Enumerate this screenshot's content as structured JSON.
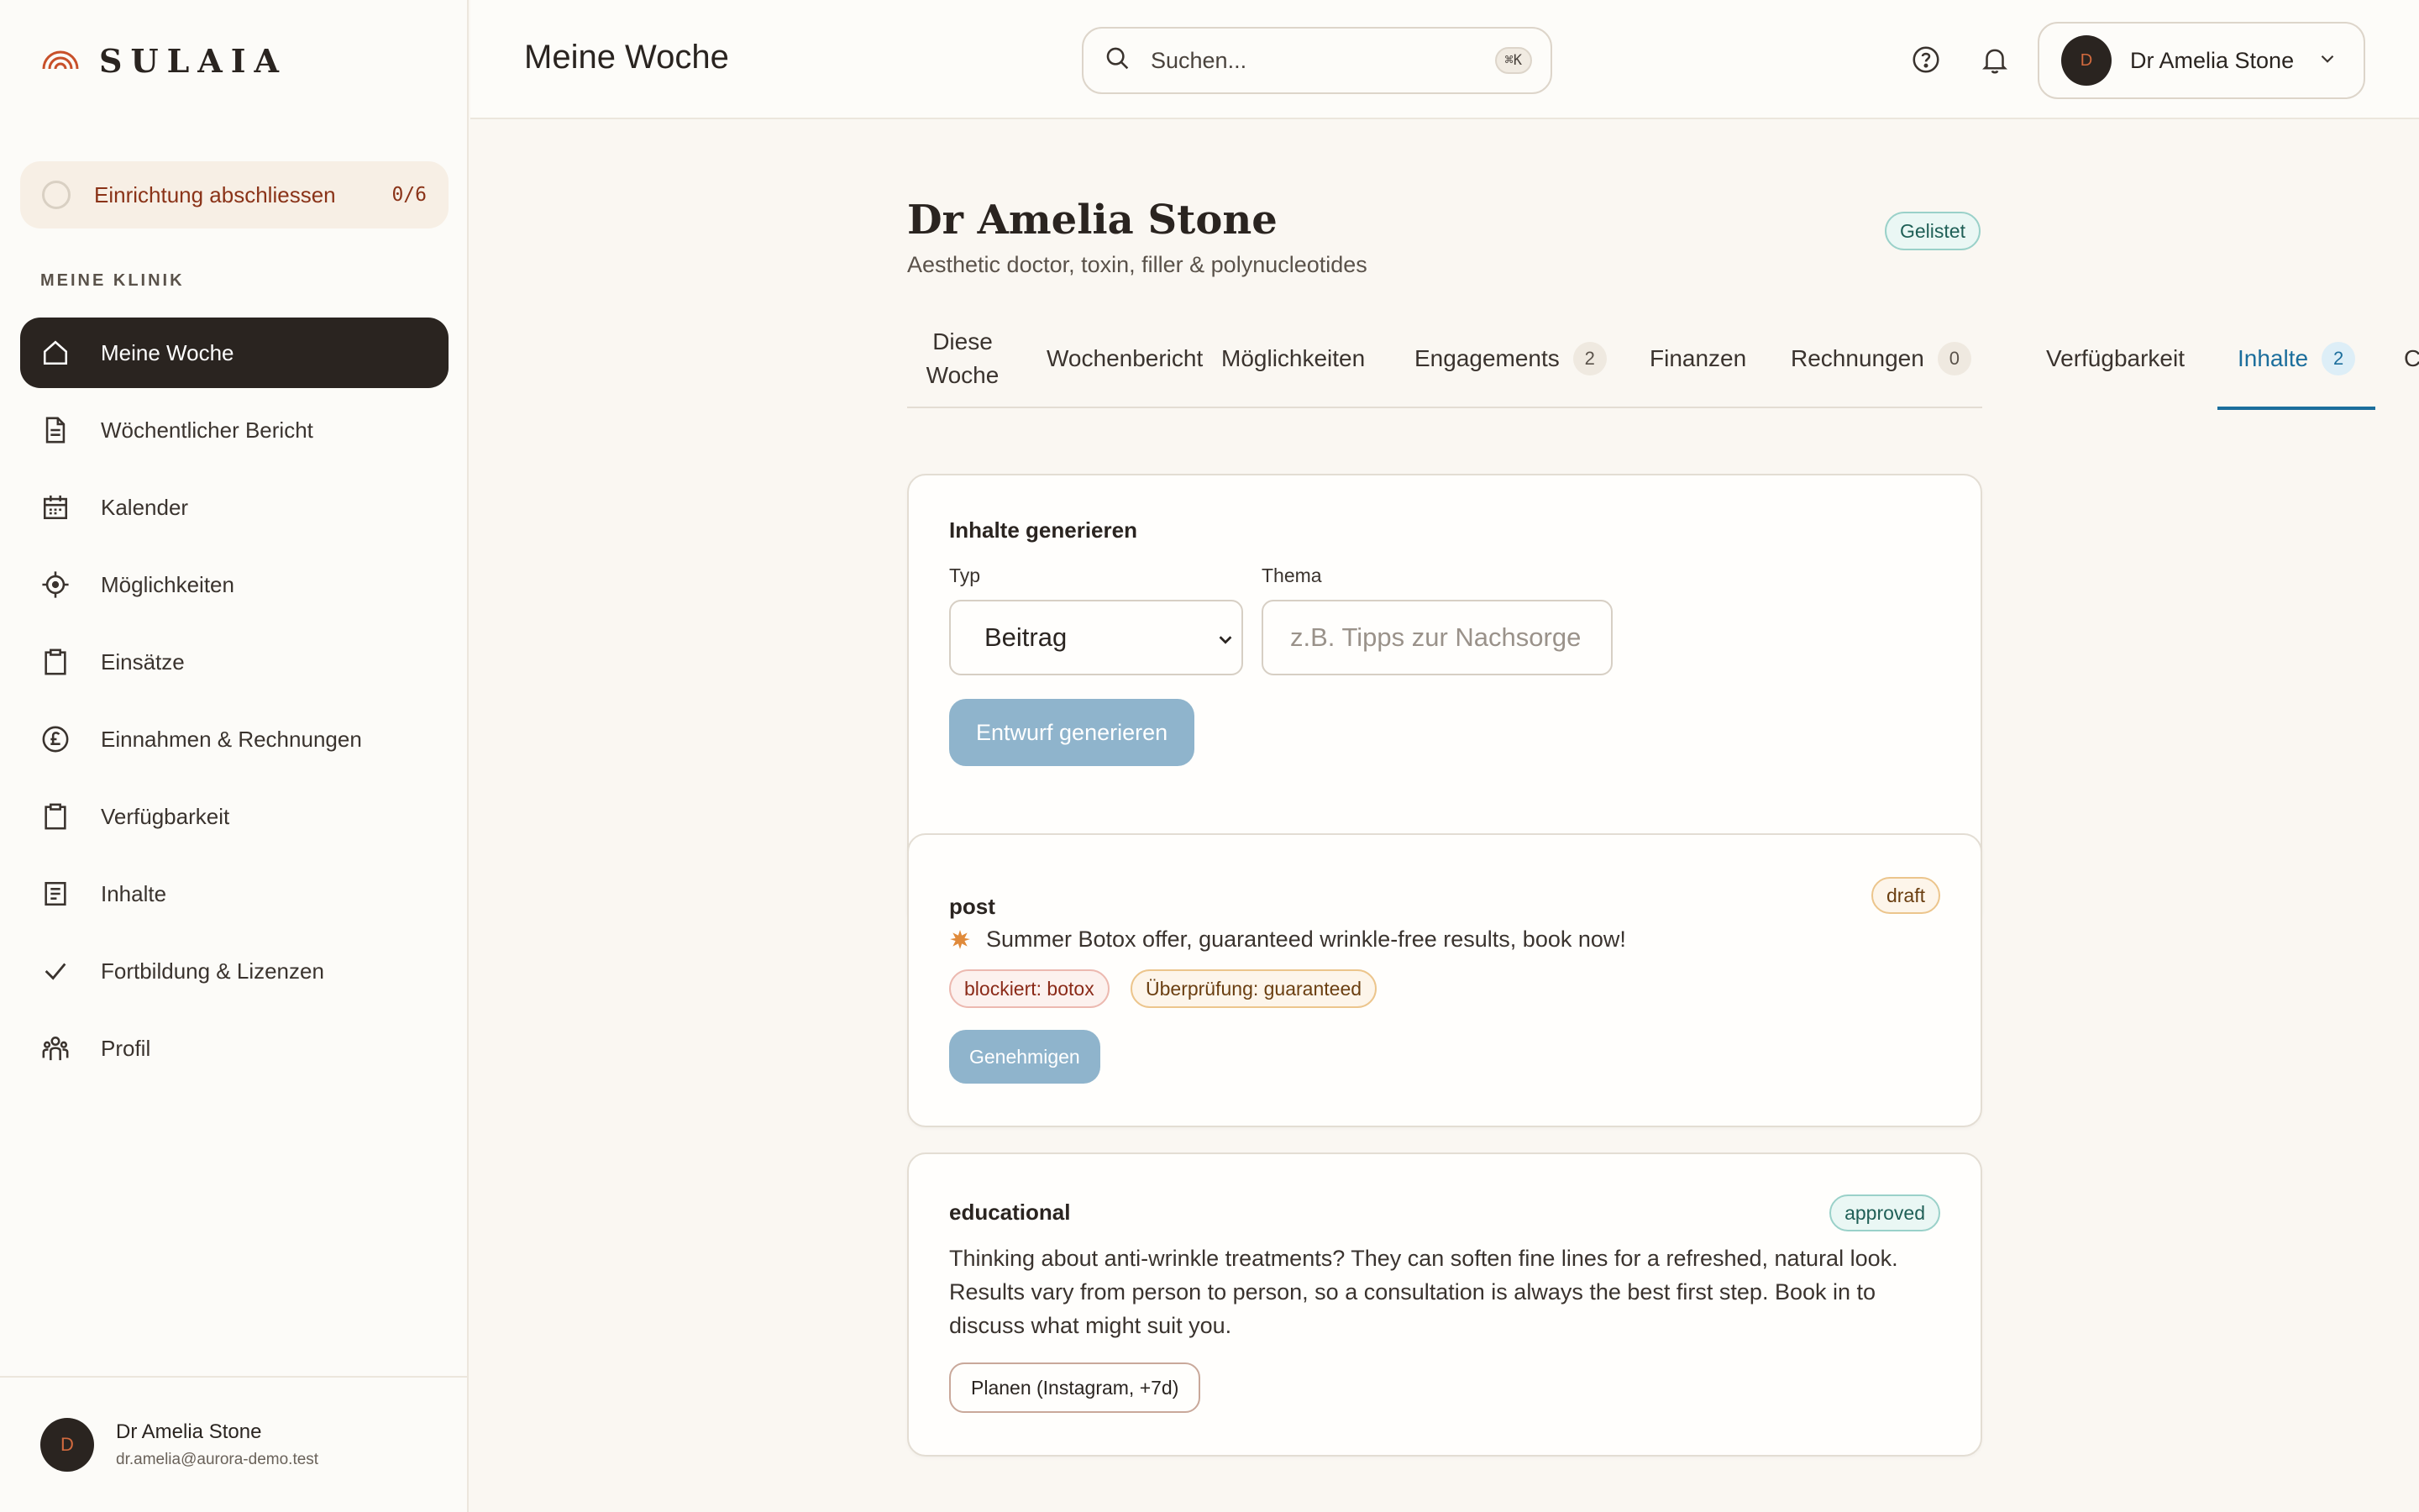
{
  "brand": {
    "name": "SULAIA"
  },
  "setup": {
    "label": "Einrichtung abschliessen",
    "count": "0/6"
  },
  "sidebar": {
    "section_label": "MEINE KLINIK",
    "items": [
      {
        "label": "Meine Woche",
        "icon": "home-icon",
        "active": true
      },
      {
        "label": "Wöchentlicher Bericht",
        "icon": "document-icon"
      },
      {
        "label": "Kalender",
        "icon": "calendar-icon"
      },
      {
        "label": "Möglichkeiten",
        "icon": "crosshair-icon"
      },
      {
        "label": "Einsätze",
        "icon": "clipboard-icon"
      },
      {
        "label": "Einnahmen & Rechnungen",
        "icon": "pound-icon"
      },
      {
        "label": "Verfügbarkeit",
        "icon": "clipboard-icon"
      },
      {
        "label": "Inhalte",
        "icon": "list-icon"
      },
      {
        "label": "Fortbildung & Lizenzen",
        "icon": "check-icon"
      },
      {
        "label": "Profil",
        "icon": "people-icon"
      }
    ],
    "footer": {
      "avatar_initial": "D",
      "name": "Dr Amelia Stone",
      "email": "dr.amelia@aurora-demo.test"
    }
  },
  "header": {
    "title": "Meine Woche",
    "search": {
      "placeholder": "Suchen...",
      "shortcut": "⌘K"
    },
    "user": {
      "avatar_initial": "D",
      "name": "Dr Amelia Stone"
    }
  },
  "profile": {
    "name": "Dr Amelia Stone",
    "subtitle": "Aesthetic doctor, toxin, filler & polynucleotides",
    "status": "Gelistet"
  },
  "tabs": [
    {
      "label": "Diese Woche"
    },
    {
      "label": "Wochenbericht"
    },
    {
      "label": "Möglichkeiten"
    },
    {
      "label": "Engagements",
      "badge": "2"
    },
    {
      "label": "Finanzen"
    },
    {
      "label": "Rechnungen",
      "badge": "0"
    },
    {
      "label": "Verfügbarkeit"
    },
    {
      "label": "Inhalte",
      "badge": "2",
      "active": true
    },
    {
      "label": "C"
    }
  ],
  "generator": {
    "title": "Inhalte generieren",
    "type_label": "Typ",
    "type_value": "Beitrag",
    "topic_label": "Thema",
    "topic_placeholder": "z.B. Tipps zur Nachsorge",
    "button": "Entwurf generieren"
  },
  "posts": [
    {
      "type": "post",
      "status": "draft",
      "text": "Summer Botox offer, guaranteed wrinkle-free results, book now!",
      "flags": [
        "blockiert: botox",
        "Überprüfung: guaranteed"
      ],
      "action": "Genehmigen"
    },
    {
      "type": "educational",
      "status": "approved",
      "text": "Thinking about anti-wrinkle treatments? They can soften fine lines for a refreshed, natural look. Results vary from person to person, so a consultation is always the best first step. Book in to discuss what might suit you.",
      "action": "Planen (Instagram, +7d)"
    }
  ],
  "colors": {
    "accent": "#1c6e9c",
    "sidebar_active": "#2a2420",
    "primary_button": "#8fb4cc",
    "brand": "#c8502a"
  }
}
